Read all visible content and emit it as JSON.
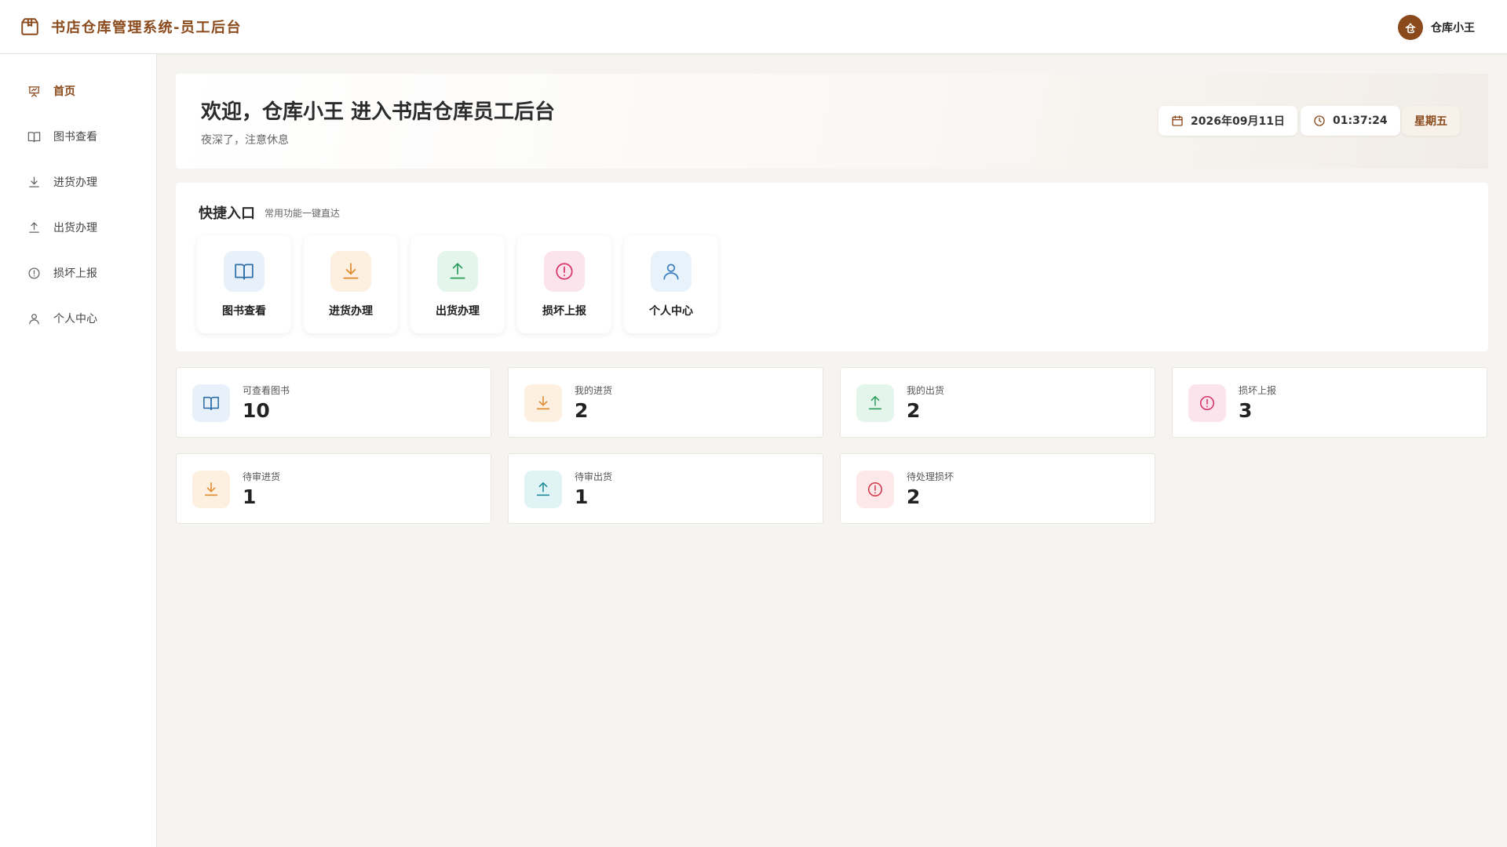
{
  "header": {
    "title": "书店仓库管理系统-员工后台",
    "brand_icon": "package-icon",
    "user": {
      "avatar_char": "仓",
      "name": "仓库小王"
    }
  },
  "sidebar": {
    "items": [
      {
        "label": "首页",
        "icon": "presentation-chart-icon",
        "active": true
      },
      {
        "label": "图书查看",
        "icon": "book-open-icon"
      },
      {
        "label": "进货办理",
        "icon": "download-icon"
      },
      {
        "label": "出货办理",
        "icon": "upload-icon"
      },
      {
        "label": "损坏上报",
        "icon": "alert-circle-icon"
      },
      {
        "label": "个人中心",
        "icon": "user-icon"
      }
    ]
  },
  "welcome": {
    "title": "欢迎，仓库小王 进入书店仓库员工后台",
    "subtitle": "夜深了，注意休息",
    "date": "2026年09月11日",
    "time": "01:37:24",
    "weekday": "星期五"
  },
  "quick": {
    "title": "快捷入口",
    "subtitle": "常用功能一键直达",
    "items": [
      {
        "label": "图书查看",
        "icon": "book-open-icon",
        "color": "#2f6fa8"
      },
      {
        "label": "进货办理",
        "icon": "download-icon",
        "color": "#e08a2e"
      },
      {
        "label": "出货办理",
        "icon": "upload-icon",
        "color": "#2e9e5f"
      },
      {
        "label": "损坏上报",
        "icon": "alert-circle-icon",
        "color": "#d6336c"
      },
      {
        "label": "个人中心",
        "icon": "user-icon",
        "color": "#3a7fc2"
      }
    ]
  },
  "stats": [
    {
      "label": "可查看图书",
      "value": "10",
      "icon": "book-open-icon",
      "color": "#2f6fa8"
    },
    {
      "label": "我的进货",
      "value": "2",
      "icon": "download-icon",
      "color": "#e08a2e"
    },
    {
      "label": "我的出货",
      "value": "2",
      "icon": "upload-icon",
      "color": "#2e9e5f"
    },
    {
      "label": "损坏上报",
      "value": "3",
      "icon": "alert-circle-icon",
      "color": "#d6336c"
    },
    {
      "label": "待审进货",
      "value": "1",
      "icon": "download-icon",
      "color": "#e08a2e"
    },
    {
      "label": "待审出货",
      "value": "1",
      "icon": "upload-icon",
      "color": "#1d8a9a"
    },
    {
      "label": "待处理损坏",
      "value": "2",
      "icon": "alert-circle-icon",
      "color": "#d23a4a"
    }
  ],
  "colors": {
    "brand": "#8a4a1c",
    "background": "#f5f4f0"
  }
}
